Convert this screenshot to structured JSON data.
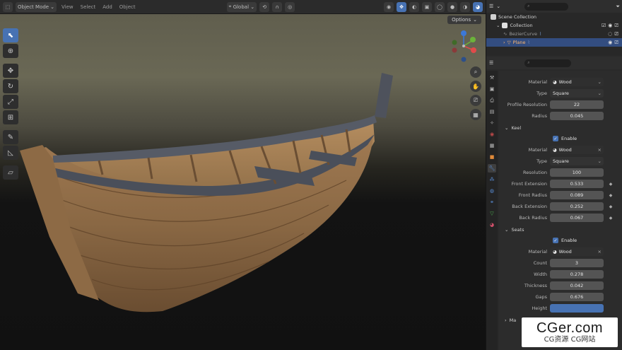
{
  "viewport_header": {
    "mode": "Object Mode",
    "menus": [
      "View",
      "Select",
      "Add",
      "Object"
    ],
    "transform_orientation": "Global",
    "options": "Options"
  },
  "toolbar": {
    "tools": [
      "select-box-icon",
      "cursor-icon",
      "move-icon",
      "rotate-icon",
      "scale-icon",
      "transform-icon",
      "annotate-icon",
      "measure-icon",
      "add-cube-icon"
    ]
  },
  "gizmo": {
    "axes": [
      "X",
      "Y",
      "Z"
    ]
  },
  "outliner": {
    "search_placeholder": "",
    "rows": [
      {
        "label": "Scene Collection",
        "indent": 0
      },
      {
        "label": "Collection",
        "indent": 1
      },
      {
        "label": "BezierCurve",
        "indent": 2
      },
      {
        "label": "Plane",
        "indent": 2,
        "selected": true
      }
    ]
  },
  "properties": {
    "search_placeholder": "",
    "material_label": "Material",
    "material_value": "Wood",
    "type_label": "Type",
    "type_value": "Square",
    "profile_label": "Profile Resolution",
    "profile_value": "22",
    "radius_label": "Radius",
    "radius_value": "0.045",
    "keel": {
      "title": "Keel",
      "enable_label": "Enable",
      "material_label": "Material",
      "material_value": "Wood",
      "type_label": "Type",
      "type_value": "Square",
      "resolution_label": "Resolution",
      "resolution_value": "100",
      "front_ext_label": "Front Extension",
      "front_ext_value": "0.533",
      "front_rad_label": "Front Radius",
      "front_rad_value": "0.089",
      "back_ext_label": "Back Extension",
      "back_ext_value": "0.252",
      "back_rad_label": "Back Radius",
      "back_rad_value": "0.067"
    },
    "seats": {
      "title": "Seats",
      "enable_label": "Enable",
      "material_label": "Material",
      "material_value": "Wood",
      "count_label": "Count",
      "count_value": "3",
      "width_label": "Width",
      "width_value": "0.278",
      "thickness_label": "Thickness",
      "thickness_value": "0.042",
      "gaps_label": "Gaps",
      "gaps_value": "0.676",
      "height_label": "Height"
    },
    "last_section": "Ma"
  },
  "watermark": {
    "title": "CGer.com",
    "subtitle": "CG资源 CG网站"
  },
  "colors": {
    "accent": "#4772b3",
    "selected_row": "#334d80",
    "selected_text": "#ffb870",
    "wood": "#8a6a47",
    "rim": "#4a4f5a"
  }
}
